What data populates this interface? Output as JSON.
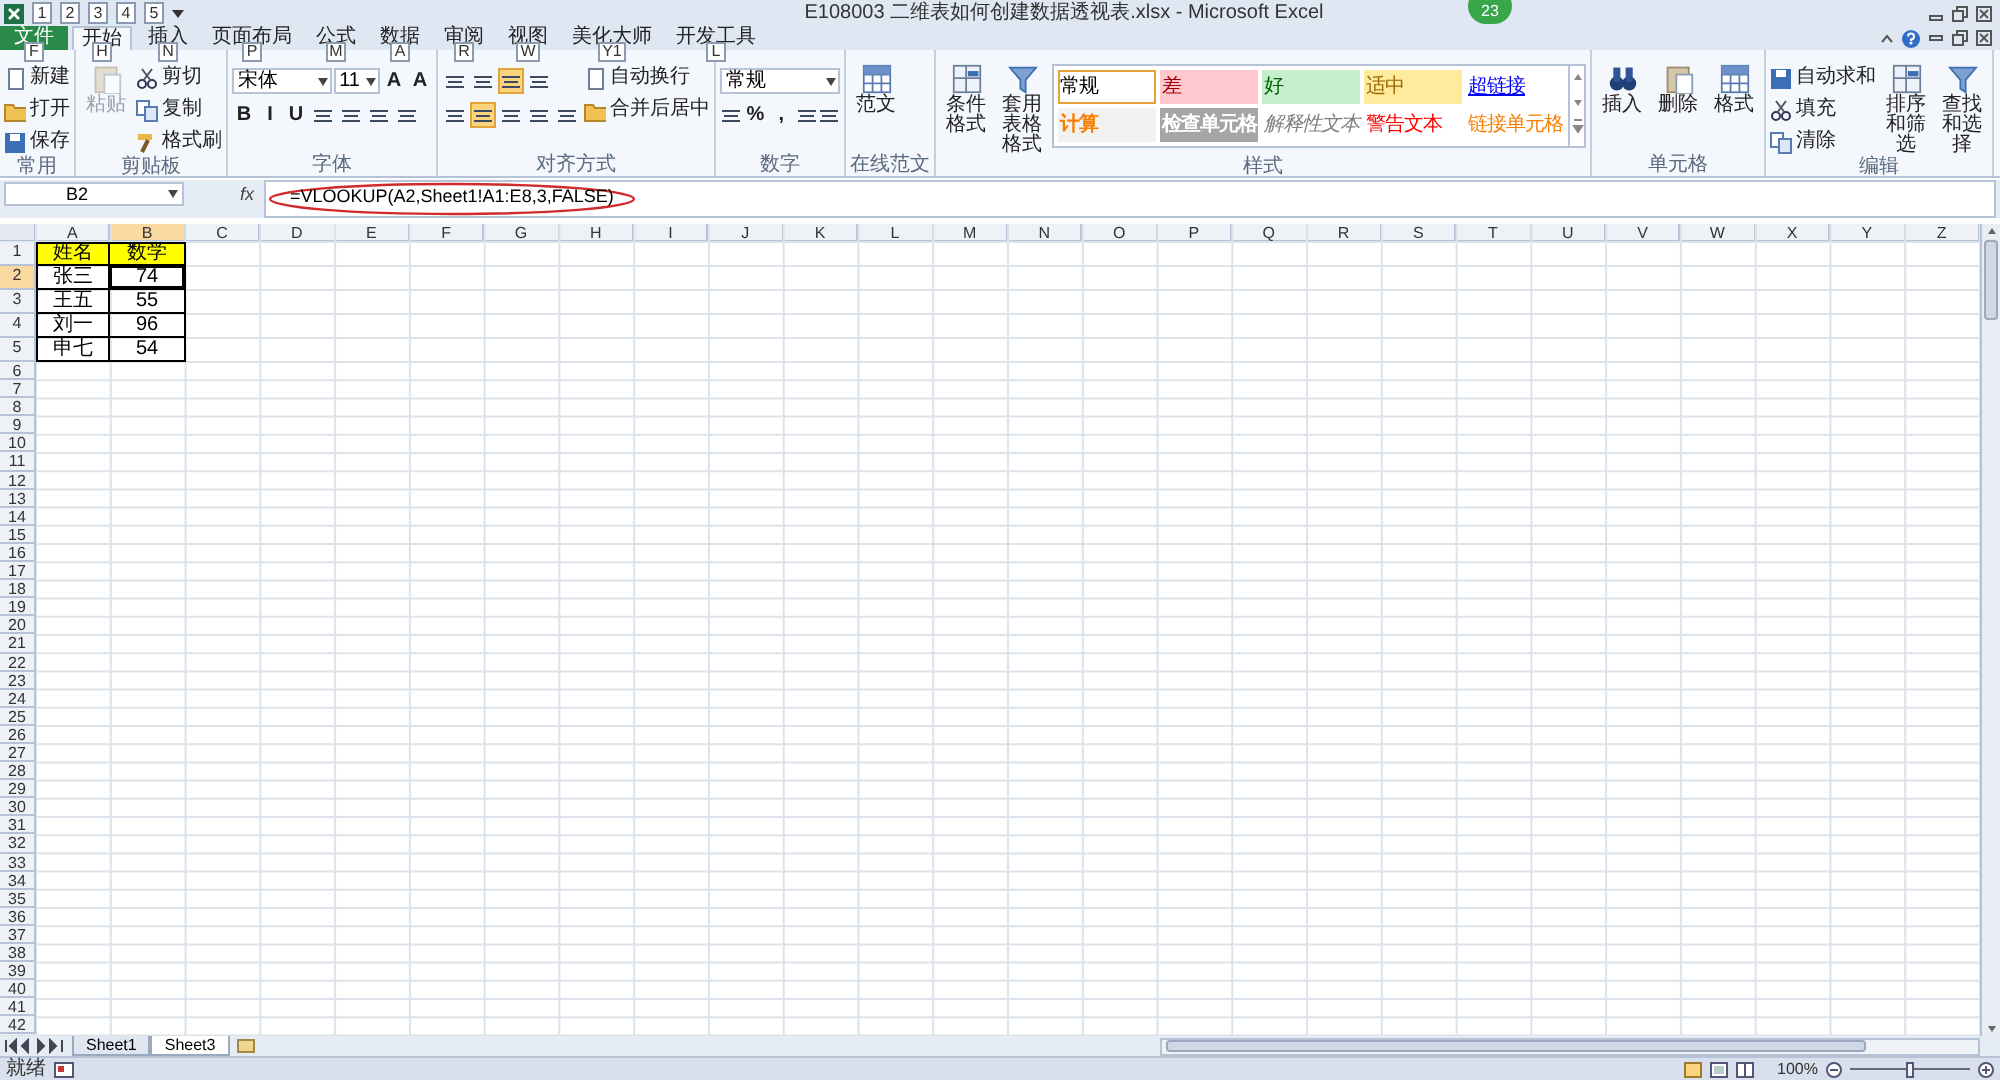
{
  "window": {
    "title": "E108003 二维表如何创建数据透视表.xlsx - Microsoft Excel",
    "badge": "23"
  },
  "quick_access": {
    "keytips": [
      "1",
      "2",
      "3",
      "4",
      "5"
    ]
  },
  "tabs": [
    {
      "kind": "file",
      "label": "文件",
      "keytip": "F",
      "selected": false
    },
    {
      "kind": "tab",
      "label": "开始",
      "keytip": "H",
      "selected": true
    },
    {
      "kind": "tab",
      "label": "插入",
      "keytip": "N",
      "selected": false
    },
    {
      "kind": "tab",
      "label": "页面布局",
      "keytip": "P",
      "selected": false
    },
    {
      "kind": "tab",
      "label": "公式",
      "keytip": "M",
      "selected": false
    },
    {
      "kind": "tab",
      "label": "数据",
      "keytip": "A",
      "selected": false
    },
    {
      "kind": "tab",
      "label": "审阅",
      "keytip": "R",
      "selected": false
    },
    {
      "kind": "tab",
      "label": "视图",
      "keytip": "W",
      "selected": false
    },
    {
      "kind": "tab",
      "label": "美化大师",
      "keytip": "Y1",
      "selected": false
    },
    {
      "kind": "tab",
      "label": "开发工具",
      "keytip": "L",
      "selected": false
    }
  ],
  "ribbon": [
    {
      "label": "常用",
      "columns": [
        [
          {
            "kind": "small",
            "label": "新建"
          },
          {
            "kind": "small",
            "label": "打开"
          },
          {
            "kind": "small",
            "label": "保存"
          }
        ]
      ]
    },
    {
      "label": "剪贴板",
      "columns": [
        [
          {
            "kind": "large",
            "label": "粘贴",
            "disabled": true
          }
        ],
        [
          {
            "kind": "small",
            "label": "剪切"
          },
          {
            "kind": "small",
            "label": "复制"
          },
          {
            "kind": "small",
            "label": "格式刷"
          }
        ]
      ]
    },
    {
      "label": "字体",
      "columns": [
        [
          {
            "kind": "row",
            "items": [
              {
                "kind": "field",
                "label": "宋体"
              },
              {
                "kind": "field",
                "label": "11"
              },
              {
                "kind": "glyph",
                "label": "A"
              },
              {
                "kind": "glyph",
                "label": "A"
              }
            ]
          },
          {
            "kind": "row",
            "items": [
              {
                "kind": "glyph",
                "label": "B"
              },
              {
                "kind": "glyph",
                "label": "I"
              },
              {
                "kind": "glyph",
                "label": "U"
              },
              {
                "kind": "icon-button"
              },
              {
                "kind": "icon-button"
              },
              {
                "kind": "icon-button"
              },
              {
                "kind": "icon-button"
              }
            ]
          }
        ]
      ]
    },
    {
      "label": "对齐方式",
      "columns": [
        [
          {
            "kind": "row",
            "items": [
              {
                "kind": "icon-button",
                "on": false
              },
              {
                "kind": "icon-button",
                "on": false
              },
              {
                "kind": "icon-button",
                "on": true
              },
              {
                "kind": "icon-button",
                "on": false
              }
            ]
          },
          {
            "kind": "row",
            "items": [
              {
                "kind": "icon-button",
                "on": false
              },
              {
                "kind": "icon-button",
                "on": true
              },
              {
                "kind": "icon-button",
                "on": false
              },
              {
                "kind": "icon-button",
                "on": false
              },
              {
                "kind": "icon-button",
                "on": false
              }
            ]
          }
        ],
        [
          {
            "kind": "small",
            "label": "自动换行"
          },
          {
            "kind": "small",
            "label": "合并后居中"
          }
        ]
      ]
    },
    {
      "label": "数字",
      "columns": [
        [
          {
            "kind": "row",
            "items": [
              {
                "kind": "field",
                "label": "常规"
              }
            ]
          },
          {
            "kind": "row",
            "items": [
              {
                "kind": "icon-button"
              },
              {
                "kind": "glyph",
                "label": "%"
              },
              {
                "kind": "glyph",
                "label": ","
              },
              {
                "kind": "icon-button"
              },
              {
                "kind": "icon-button"
              }
            ]
          }
        ]
      ]
    },
    {
      "label": "在线范文",
      "columns": [
        [
          {
            "kind": "large",
            "label": "范文",
            "disabled": false
          }
        ]
      ]
    },
    {
      "label": "样式",
      "columns": [
        [
          {
            "kind": "large",
            "label": "条件格式",
            "disabled": false
          }
        ],
        [
          {
            "kind": "large",
            "label": "套用表格格式",
            "disabled": false
          }
        ],
        [
          {
            "kind": "gallery",
            "styles": [
              {
                "label": "常规",
                "kind": "normal",
                "color": "#ffffff",
                "selected": true
              },
              {
                "label": "差",
                "kind": "bad",
                "color": "#ffc7ce",
                "selected": false
              },
              {
                "label": "好",
                "kind": "good",
                "color": "#c6efce",
                "selected": false
              },
              {
                "label": "适中",
                "kind": "neutral",
                "color": "#ffeb9c",
                "selected": false
              },
              {
                "label": "超链接",
                "kind": "hyperlink",
                "color": "#ffffff",
                "selected": false
              },
              {
                "label": "计算",
                "kind": "calculation",
                "color": "#f2f2f2",
                "selected": false
              },
              {
                "label": "检查单元格",
                "kind": "check",
                "color": "#a5a5a5",
                "selected": false
              },
              {
                "label": "解释性文本",
                "kind": "explanatory",
                "color": "#ffffff",
                "selected": false
              },
              {
                "label": "警告文本",
                "kind": "warning",
                "color": "#ffffff",
                "selected": false
              },
              {
                "label": "链接单元格",
                "kind": "linked",
                "color": "#ffffff",
                "selected": false
              }
            ]
          }
        ]
      ]
    },
    {
      "label": "单元格",
      "columns": [
        [
          {
            "kind": "large",
            "label": "插入",
            "disabled": false
          }
        ],
        [
          {
            "kind": "large",
            "label": "删除",
            "disabled": false
          }
        ],
        [
          {
            "kind": "large",
            "label": "格式",
            "disabled": false
          }
        ]
      ]
    },
    {
      "label": "编辑",
      "columns": [
        [
          {
            "kind": "small",
            "label": "自动求和"
          },
          {
            "kind": "small",
            "label": "填充"
          },
          {
            "kind": "small",
            "label": "清除"
          }
        ],
        [
          {
            "kind": "large",
            "label": "排序和筛选",
            "disabled": false
          }
        ],
        [
          {
            "kind": "large",
            "label": "查找和选择",
            "disabled": false
          }
        ]
      ]
    }
  ],
  "formula_bar": {
    "name_box": "B2",
    "function_label": "fx",
    "formula": "=VLOOKUP(A2,Sheet1!A1:E8,3,FALSE)",
    "circled": true
  },
  "sheet": {
    "columns": [
      "A",
      "B",
      "C",
      "D",
      "E",
      "F",
      "G",
      "H",
      "I",
      "J",
      "K",
      "L",
      "M",
      "N",
      "O",
      "P",
      "Q",
      "R",
      "S",
      "T",
      "U",
      "V",
      "W",
      "X",
      "Y",
      "Z"
    ],
    "rows": [
      {
        "number": "1",
        "kind": "header",
        "cells": [
          {
            "text": "姓名",
            "selected": false
          },
          {
            "text": "数学",
            "selected": false
          }
        ]
      },
      {
        "number": "2",
        "kind": "data",
        "cells": [
          {
            "text": "张三",
            "selected": false
          },
          {
            "text": "74",
            "selected": true
          }
        ]
      },
      {
        "number": "3",
        "kind": "data",
        "cells": [
          {
            "text": "王五",
            "selected": false
          },
          {
            "text": "55",
            "selected": false
          }
        ]
      },
      {
        "number": "4",
        "kind": "data",
        "cells": [
          {
            "text": "刘一",
            "selected": false
          },
          {
            "text": "96",
            "selected": false
          }
        ]
      },
      {
        "number": "5",
        "kind": "data",
        "cells": [
          {
            "text": "申七",
            "selected": false
          },
          {
            "text": "54",
            "selected": false
          }
        ]
      },
      {
        "number": "6"
      },
      {
        "number": "7"
      },
      {
        "number": "8"
      },
      {
        "number": "9"
      },
      {
        "number": "10"
      },
      {
        "number": "11"
      },
      {
        "number": "12"
      },
      {
        "number": "13"
      },
      {
        "number": "14"
      },
      {
        "number": "15"
      },
      {
        "number": "16"
      },
      {
        "number": "17"
      },
      {
        "number": "18"
      },
      {
        "number": "19"
      },
      {
        "number": "20"
      },
      {
        "number": "21"
      },
      {
        "number": "22"
      },
      {
        "number": "23"
      },
      {
        "number": "24"
      },
      {
        "number": "25"
      },
      {
        "number": "26"
      },
      {
        "number": "27"
      },
      {
        "number": "28"
      },
      {
        "number": "29"
      },
      {
        "number": "30"
      },
      {
        "number": "31"
      },
      {
        "number": "32"
      },
      {
        "number": "33"
      },
      {
        "number": "34"
      },
      {
        "number": "35"
      },
      {
        "number": "36"
      },
      {
        "number": "37"
      },
      {
        "number": "38"
      },
      {
        "number": "39"
      },
      {
        "number": "40"
      },
      {
        "number": "41"
      },
      {
        "number": "42"
      }
    ]
  },
  "sheet_tabs": [
    {
      "label": "Sheet1",
      "selected": false
    },
    {
      "label": "Sheet3",
      "selected": true
    }
  ],
  "status_bar": {
    "status": "就绪",
    "zoom": "100%",
    "zoom_slider": {
      "level": 0.5
    }
  }
}
